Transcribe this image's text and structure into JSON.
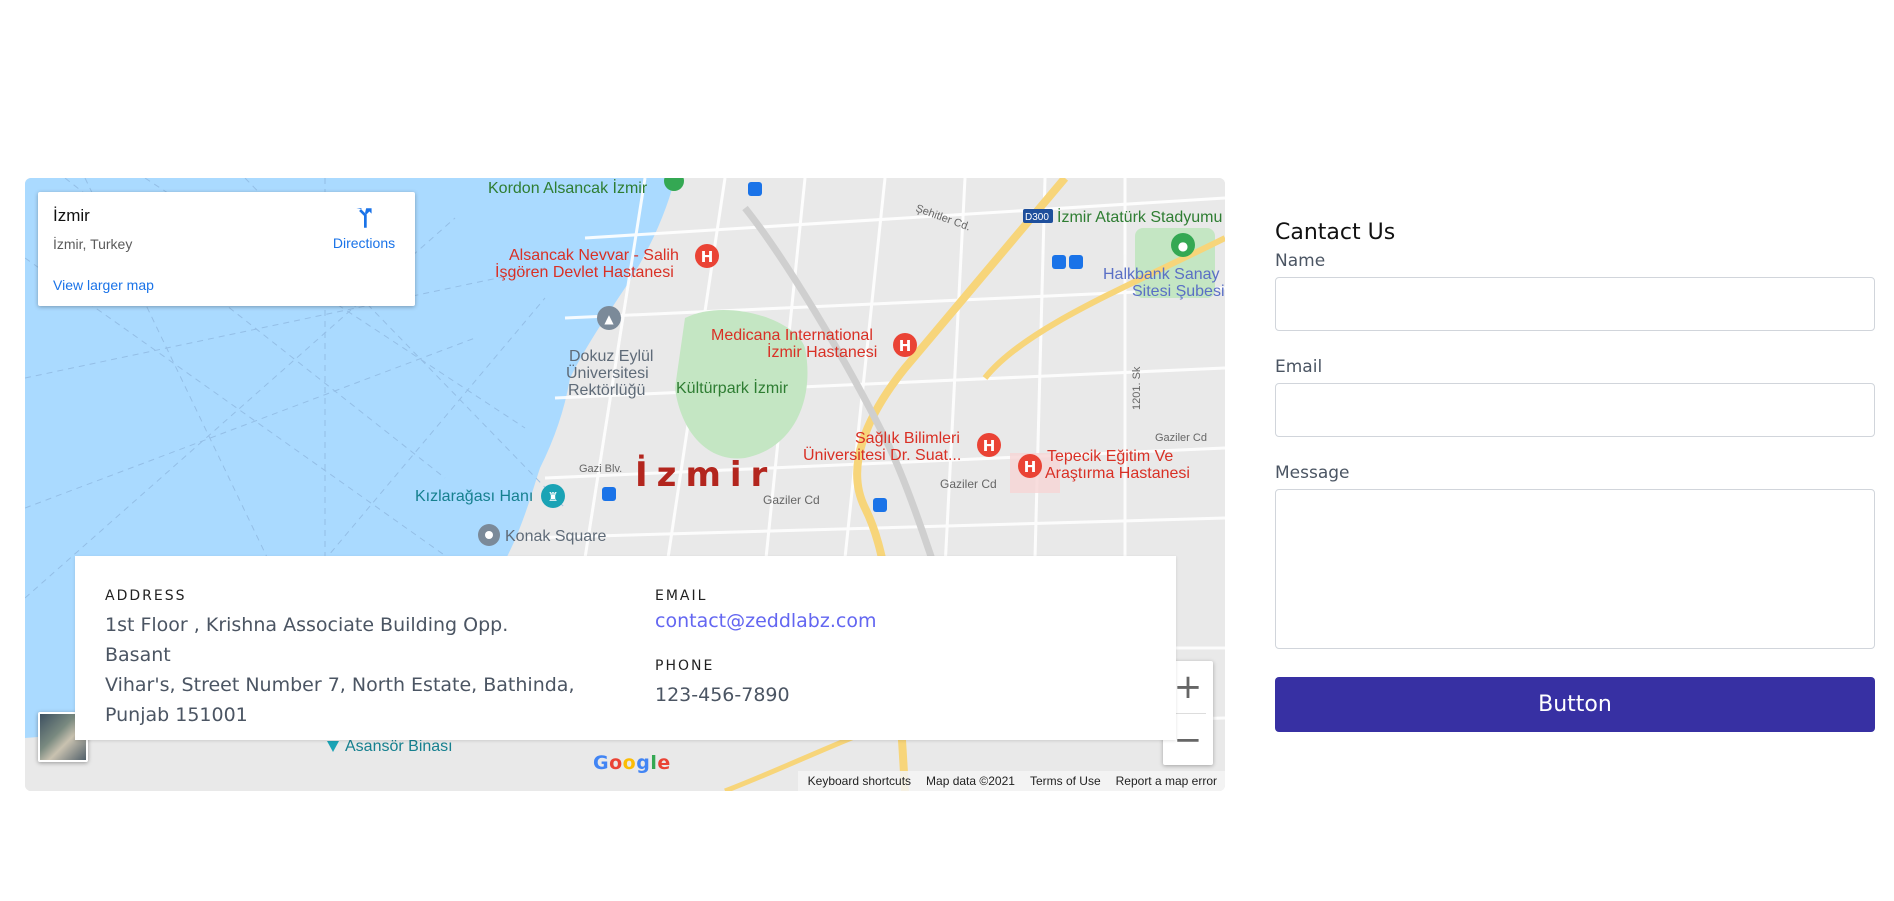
{
  "map": {
    "place_card": {
      "name": "İzmir",
      "address": "İzmir, Turkey",
      "directions_label": "Directions",
      "view_larger_label": "View larger map"
    },
    "city_label": "İzmir",
    "labels": {
      "kordon": "Kordon Alsancak İzmir",
      "alsancak1": "Alsancak Nevvar - Salih",
      "alsancak2": "İşgören Devlet Hastanesi",
      "medicana1": "Medicana International",
      "medicana2": "İzmir Hastanesi",
      "dokuz1": "Dokuz Eylül",
      "dokuz2": "Üniversitesi",
      "dokuz3": "Rektörlüğü",
      "kultur": "Kültürpark İzmir",
      "saglik1": "Sağlık Bilimleri",
      "saglik2": "Üniversitesi Dr. Suat...",
      "tepecik1": "Tepecik Eğitim Ve",
      "tepecik2": "Araştırma Hastanesi",
      "kizlar": "Kızlarağası Hanı",
      "konak": "Konak Square",
      "ataturk": "İzmir Atatürk Stadyumu",
      "halkbank1": "Halkbank Sanay",
      "halkbank2": "Sitesi Şubesi",
      "sehitler": "Şehitler Cd.",
      "gazi": "Gazi Blv.",
      "gaziler1": "Gaziler Cd",
      "gaziler2": "Gaziler Cd",
      "gaziler3": "Gaziler Cd",
      "sk1201": "1201. Sk",
      "d300": "D300",
      "asansor": "Asansör Binası"
    },
    "zoom_in": "+",
    "zoom_out": "−",
    "google": [
      "G",
      "o",
      "o",
      "g",
      "l",
      "e"
    ],
    "attribution": {
      "keyboard": "Keyboard shortcuts",
      "mapdata": "Map data ©2021",
      "terms": "Terms of Use",
      "report": "Report a map error"
    }
  },
  "info": {
    "address_heading": "ADDRESS",
    "address_lines": [
      "1st Floor , Krishna Associate Building Opp. Basant",
      "Vihar's, Street Number 7, North Estate, Bathinda,",
      "Punjab 151001"
    ],
    "email_heading": "EMAIL",
    "email": "contact@zeddlabz.com",
    "phone_heading": "PHONE",
    "phone": "123-456-7890"
  },
  "form": {
    "title": "Cantact Us",
    "name_label": "Name",
    "email_label": "Email",
    "message_label": "Message",
    "submit_label": "Button"
  },
  "colors": {
    "water": "#aadaff",
    "land": "#e8e8e8",
    "park": "#c5e8c5",
    "highway": "#fde293",
    "hospital": "#ea4335",
    "accent": "#3730a3",
    "link": "#6366f1"
  }
}
